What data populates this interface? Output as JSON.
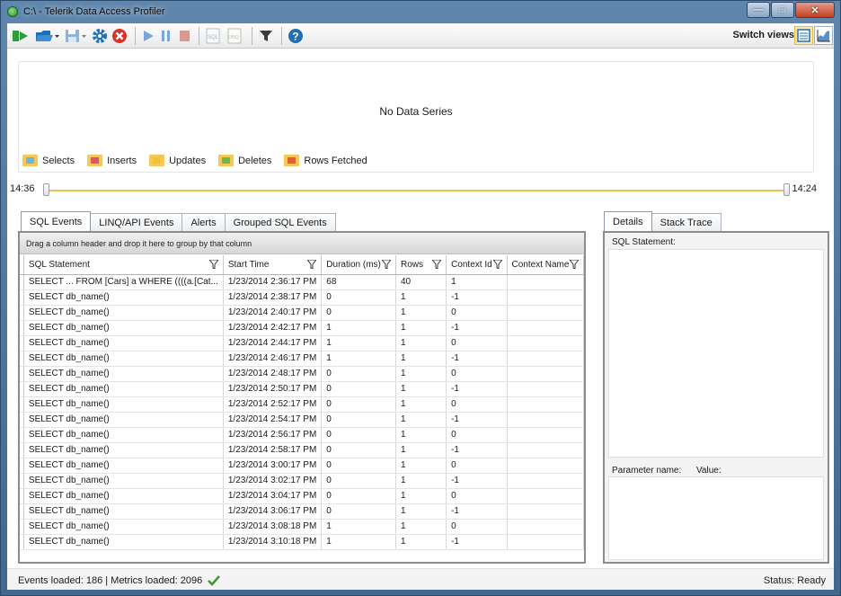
{
  "window": {
    "title": "C:\\ - Telerik Data Access Profiler"
  },
  "toolbar": {
    "switch_views_label": "Switch views",
    "buttons": [
      "connect-icon",
      "open-folder-icon",
      "save-icon",
      "settings-gear-icon",
      "stop-red-icon",
      "play-icon",
      "pause-icon",
      "stop-icon",
      "sql-icon",
      "linq-icon",
      "filter-icon",
      "help-icon"
    ]
  },
  "chart": {
    "empty_message": "No Data Series",
    "legend": [
      {
        "label": "Selects",
        "color": "#6fb6de"
      },
      {
        "label": "Inserts",
        "color": "#e0566a"
      },
      {
        "label": "Updates",
        "color": "#f0c13a"
      },
      {
        "label": "Deletes",
        "color": "#6fb94a"
      },
      {
        "label": "Rows Fetched",
        "color": "#e0612d"
      }
    ]
  },
  "timeline": {
    "start": "14:36",
    "end": "14:24"
  },
  "tabs": [
    "SQL Events",
    "LINQ/API Events",
    "Alerts",
    "Grouped SQL Events"
  ],
  "grid": {
    "group_hint": "Drag a column header and drop it here to group by that column",
    "columns": [
      "SQL Statement",
      "Start Time",
      "Duration (ms)",
      "Rows",
      "Context Id",
      "Context Name"
    ],
    "rows": [
      [
        "SELECT ... FROM [Cars] a WHERE ((((a.[Cat...",
        "1/23/2014 2:36:17 PM",
        "68",
        "40",
        "1",
        ""
      ],
      [
        "SELECT db_name()",
        "1/23/2014 2:38:17 PM",
        "0",
        "1",
        "-1",
        ""
      ],
      [
        "SELECT db_name()",
        "1/23/2014 2:40:17 PM",
        "0",
        "1",
        "0",
        ""
      ],
      [
        "SELECT db_name()",
        "1/23/2014 2:42:17 PM",
        "1",
        "1",
        "-1",
        ""
      ],
      [
        "SELECT db_name()",
        "1/23/2014 2:44:17 PM",
        "1",
        "1",
        "0",
        ""
      ],
      [
        "SELECT db_name()",
        "1/23/2014 2:46:17 PM",
        "1",
        "1",
        "-1",
        ""
      ],
      [
        "SELECT db_name()",
        "1/23/2014 2:48:17 PM",
        "0",
        "1",
        "0",
        ""
      ],
      [
        "SELECT db_name()",
        "1/23/2014 2:50:17 PM",
        "0",
        "1",
        "-1",
        ""
      ],
      [
        "SELECT db_name()",
        "1/23/2014 2:52:17 PM",
        "0",
        "1",
        "0",
        ""
      ],
      [
        "SELECT db_name()",
        "1/23/2014 2:54:17 PM",
        "0",
        "1",
        "-1",
        ""
      ],
      [
        "SELECT db_name()",
        "1/23/2014 2:56:17 PM",
        "0",
        "1",
        "0",
        ""
      ],
      [
        "SELECT db_name()",
        "1/23/2014 2:58:17 PM",
        "0",
        "1",
        "-1",
        ""
      ],
      [
        "SELECT db_name()",
        "1/23/2014 3:00:17 PM",
        "0",
        "1",
        "0",
        ""
      ],
      [
        "SELECT db_name()",
        "1/23/2014 3:02:17 PM",
        "0",
        "1",
        "-1",
        ""
      ],
      [
        "SELECT db_name()",
        "1/23/2014 3:04:17 PM",
        "0",
        "1",
        "0",
        ""
      ],
      [
        "SELECT db_name()",
        "1/23/2014 3:06:17 PM",
        "0",
        "1",
        "-1",
        ""
      ],
      [
        "SELECT db_name()",
        "1/23/2014 3:08:18 PM",
        "1",
        "1",
        "0",
        ""
      ],
      [
        "SELECT db_name()",
        "1/23/2014 3:10:18 PM",
        "1",
        "1",
        "-1",
        ""
      ]
    ]
  },
  "details": {
    "tabs": [
      "Details",
      "Stack Trace"
    ],
    "sql_statement_label": "SQL Statement:",
    "parameter_name_label": "Parameter name:",
    "value_label": "Value:"
  },
  "status": {
    "loaded": "Events loaded: 186 | Metrics loaded: 2096",
    "ready": "Status: Ready"
  }
}
